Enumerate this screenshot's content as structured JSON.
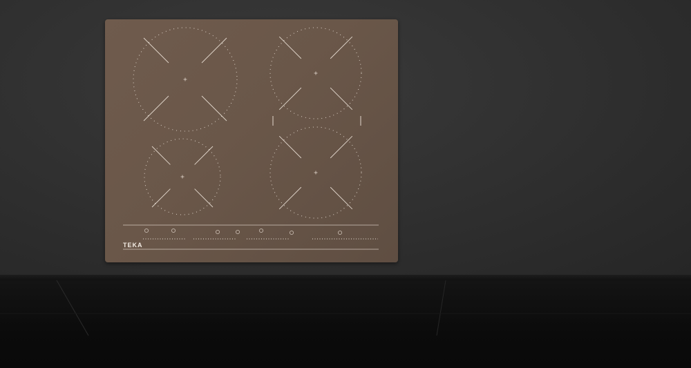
{
  "scene": {
    "colors": {
      "wall": "#2e2e2e",
      "glass": "#6a5749",
      "lines": "#f0e6dc",
      "cabinet": "#0e0e0e"
    }
  },
  "hob": {
    "brand": "TEKA",
    "top_badge": "",
    "bottom_badge": "",
    "function_labels": []
  }
}
